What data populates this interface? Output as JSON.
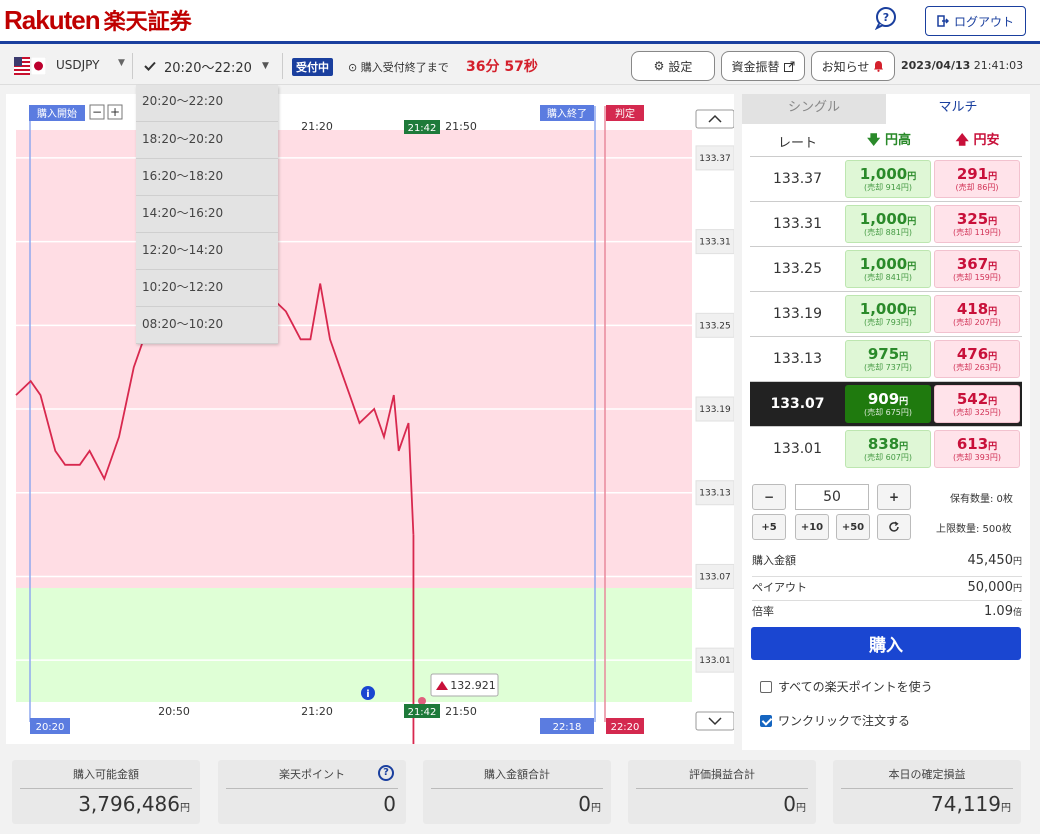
{
  "brand": {
    "name": "Rakuten",
    "jp": "楽天証券"
  },
  "header": {
    "logout_label": "ログアウト"
  },
  "toolbar": {
    "pair": "USDJPY",
    "period": "20:20～22:20",
    "status_badge": "受付中",
    "until_label": "購入受付終了まで",
    "countdown": "36分 57秒",
    "settings_label": "設定",
    "transfer_label": "資金振替",
    "notice_label": "お知らせ",
    "date": "2023/04/13",
    "time": "21:41:03"
  },
  "period_options": [
    "20:20～22:20",
    "18:20～20:20",
    "16:20～18:20",
    "14:20～16:20",
    "12:20～14:20",
    "10:20～12:20",
    "08:20～10:20"
  ],
  "chart": {
    "start_label": "購入開始",
    "end_label": "購入終了",
    "judge_label": "判定",
    "top_times": [
      "21:20",
      "21:50"
    ],
    "top_current": "21:42",
    "bottom_start": "20:20",
    "bottom_times": [
      "20:50",
      "21:20",
      "21:50"
    ],
    "bottom_current": "21:42",
    "bottom_end": "22:18",
    "bottom_judge": "22:20",
    "price_tag": "132.921",
    "y_labels": [
      "133.37",
      "133.31",
      "133.25",
      "133.19",
      "133.13",
      "133.07",
      "133.01"
    ],
    "colors": {
      "upper_zone": "#ffdde4",
      "lower_zone": "#dfffd6",
      "line": "#d8284e"
    }
  },
  "chart_data": {
    "type": "line",
    "title": "",
    "xlabel": "",
    "ylabel": "",
    "ylim": [
      132.98,
      133.39
    ],
    "x": [
      "20:20",
      "20:23",
      "20:25",
      "20:28",
      "20:30",
      "20:33",
      "20:35",
      "20:38",
      "20:41",
      "20:44",
      "20:47",
      "20:50",
      "20:52",
      "20:54",
      "20:56",
      "20:58",
      "21:00",
      "21:03",
      "21:06",
      "21:09",
      "21:12",
      "21:15",
      "21:18",
      "21:20",
      "21:22",
      "21:24",
      "21:26",
      "21:28",
      "21:30",
      "21:33",
      "21:35",
      "21:37",
      "21:38",
      "21:39",
      "21:40",
      "21:41",
      "21:42"
    ],
    "values": [
      133.2,
      133.21,
      133.2,
      133.16,
      133.15,
      133.15,
      133.16,
      133.14,
      133.17,
      133.22,
      133.25,
      133.24,
      133.24,
      133.25,
      133.27,
      133.28,
      133.26,
      133.25,
      133.25,
      133.26,
      133.27,
      133.26,
      133.24,
      133.24,
      133.28,
      133.24,
      133.22,
      133.2,
      133.18,
      133.19,
      133.17,
      133.2,
      133.16,
      133.17,
      133.18,
      133.1,
      132.921
    ],
    "strike_rates": [
      "133.37",
      "133.31",
      "133.25",
      "133.19",
      "133.13",
      "133.07",
      "133.01"
    ]
  },
  "trade": {
    "tab_single": "シングル",
    "tab_multi": "マルチ",
    "col_rate": "レート",
    "col_up": "円高",
    "col_down": "円安",
    "rows": [
      {
        "rate": "133.37",
        "up": "1,000",
        "up_sell": "(売却 914円)",
        "down": "291",
        "down_sell": "(売却 86円)"
      },
      {
        "rate": "133.31",
        "up": "1,000",
        "up_sell": "(売却 881円)",
        "down": "325",
        "down_sell": "(売却 119円)"
      },
      {
        "rate": "133.25",
        "up": "1,000",
        "up_sell": "(売却 841円)",
        "down": "367",
        "down_sell": "(売却 159円)"
      },
      {
        "rate": "133.19",
        "up": "1,000",
        "up_sell": "(売却 793円)",
        "down": "418",
        "down_sell": "(売却 207円)"
      },
      {
        "rate": "133.13",
        "up": "975",
        "up_sell": "(売却 737円)",
        "down": "476",
        "down_sell": "(売却 263円)"
      },
      {
        "rate": "133.07",
        "up": "909",
        "up_sell": "(売却 675円)",
        "down": "542",
        "down_sell": "(売却 325円)"
      },
      {
        "rate": "133.01",
        "up": "838",
        "up_sell": "(売却 607円)",
        "down": "613",
        "down_sell": "(売却 393円)"
      }
    ],
    "yen": "円",
    "quantity": "50",
    "minus": "−",
    "plus": "+",
    "plus5": "+5",
    "plus10": "+10",
    "plus50": "+50",
    "holding": "保有数量: 0枚",
    "limit": "上限数量: 500枚",
    "purchase_amount_label": "購入金額",
    "purchase_amount": "45,450",
    "payout_label": "ペイアウト",
    "payout": "50,000",
    "multiplier_label": "倍率",
    "multiplier": "1.09",
    "multiplier_unit": "倍",
    "buy_label": "購入",
    "use_points_label": "すべての楽天ポイントを使う",
    "one_click_label": "ワンクリックで注文する"
  },
  "summary": [
    {
      "label": "購入可能金額",
      "value": "3,796,486",
      "unit": "円"
    },
    {
      "label": "楽天ポイント",
      "value": "0",
      "unit": ""
    },
    {
      "label": "購入金額合計",
      "value": "0",
      "unit": "円"
    },
    {
      "label": "評価損益合計",
      "value": "0",
      "unit": "円"
    },
    {
      "label": "本日の確定損益",
      "value": "74,119",
      "unit": "円"
    }
  ]
}
